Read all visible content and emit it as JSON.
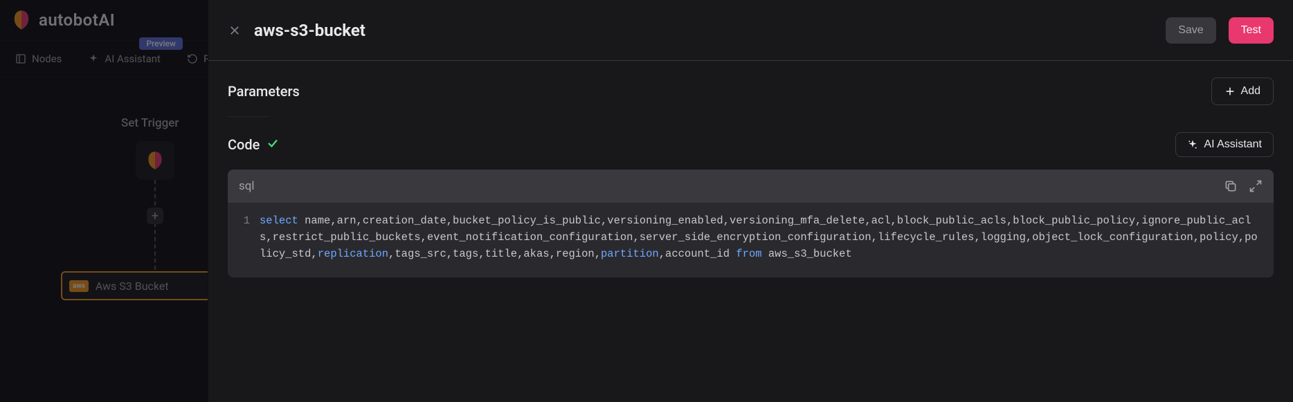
{
  "brand": {
    "name": "autobotAI"
  },
  "nav": {
    "nodes": "Nodes",
    "ai_assistant": "AI Assistant",
    "preview_badge": "Preview",
    "reset": "Reset"
  },
  "canvas": {
    "set_trigger": "Set Trigger",
    "bucket_node_label": "Aws S3 Bucket",
    "aws_badge": "aws"
  },
  "panel": {
    "title": "aws-s3-bucket",
    "save": "Save",
    "test": "Test"
  },
  "sections": {
    "parameters": "Parameters",
    "add": "Add",
    "code": "Code",
    "ai_assistant_btn": "AI Assistant"
  },
  "code": {
    "lang": "sql",
    "line_no": "1",
    "kw_select": "select",
    "body1": " name,arn,creation_date,bucket_policy_is_public,versioning_enabled,versioning_mfa_delete,acl,block_public_acls,block_public_policy,ignore_public_acls,restrict_public_buckets,event_notification_configuration,server_side_encryption_configuration,lifecycle_rules,logging,object_lock_configuration,policy,policy_std,",
    "kw_replication": "replication",
    "body2": ",tags_src,tags,title,akas,region,",
    "kw_partition": "partition",
    "body3": ",account_id ",
    "kw_from": "from",
    "body4": " aws_s3_bucket"
  }
}
